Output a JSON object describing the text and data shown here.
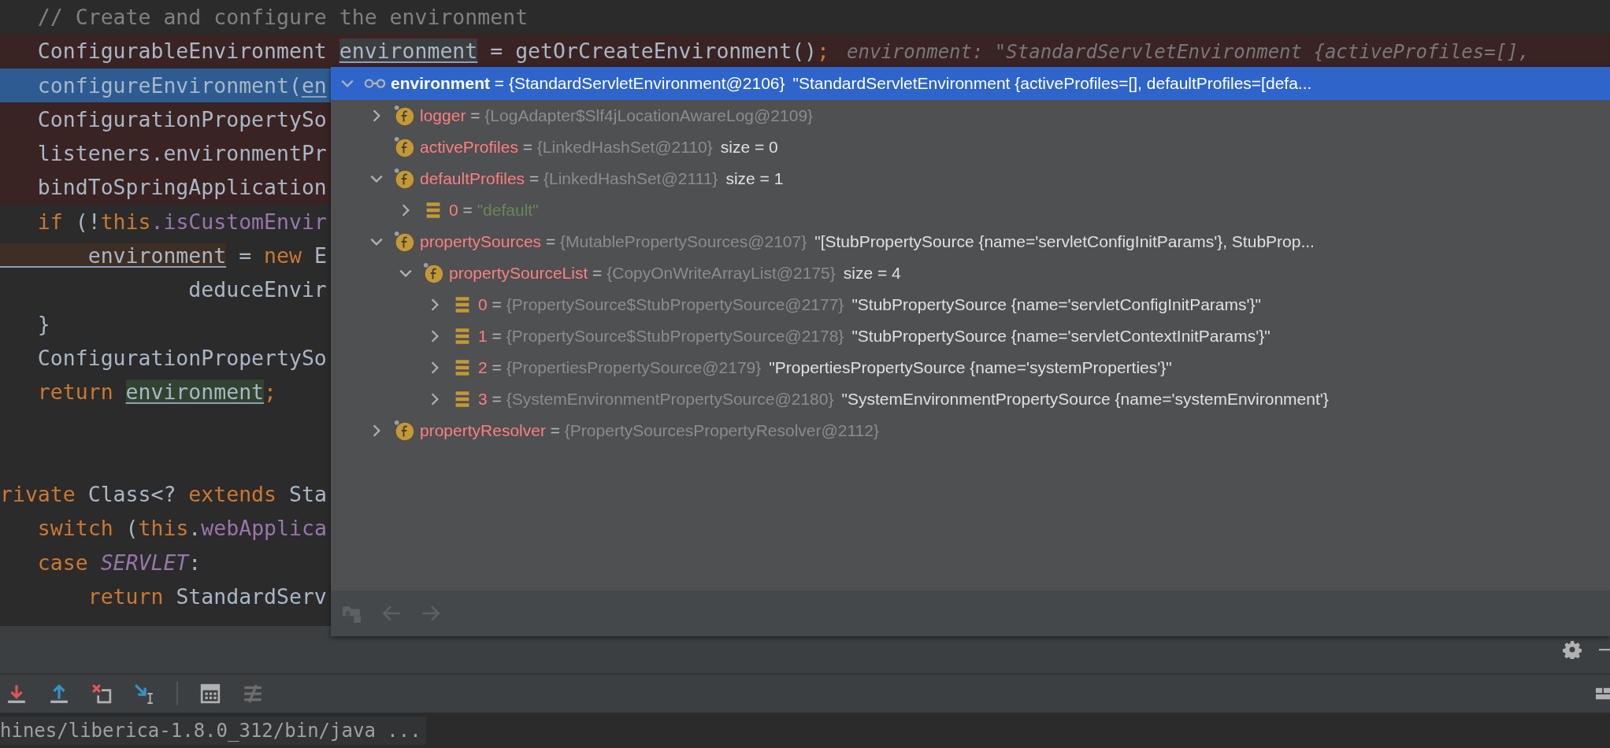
{
  "editor": {
    "lines": [
      {
        "breakpoint": false,
        "execution_point": false,
        "segments": [
          {
            "text": "   // Create and configure the environment",
            "kind": "comment"
          }
        ]
      },
      {
        "breakpoint": true,
        "execution_point": false,
        "segments": [
          {
            "text": "   ConfigurableEnvironment ",
            "kind": "plain"
          },
          {
            "text": "environment",
            "kind": "ref-hover"
          },
          {
            "text": " = getOrCreateEnvironment()",
            "kind": "plain"
          },
          {
            "text": ";",
            "kind": "keyword"
          },
          {
            "text": "environment: \"StandardServletEnvironment {activeProfiles=[],",
            "kind": "hint"
          }
        ]
      },
      {
        "breakpoint": false,
        "execution_point": true,
        "segments": [
          {
            "text": "   configureEnvironment(",
            "kind": "plain"
          },
          {
            "text": "en",
            "kind": "ref"
          }
        ]
      },
      {
        "breakpoint": true,
        "execution_point": false,
        "segments": [
          {
            "text": "   ConfigurationPropertySo",
            "kind": "plain"
          }
        ]
      },
      {
        "breakpoint": true,
        "execution_point": false,
        "segments": [
          {
            "text": "   listeners.environmentPr",
            "kind": "plain"
          }
        ]
      },
      {
        "breakpoint": true,
        "execution_point": false,
        "segments": [
          {
            "text": "   bindToSpringApplication",
            "kind": "plain"
          }
        ]
      },
      {
        "breakpoint": false,
        "execution_point": false,
        "segments": [
          {
            "text": "   if",
            "kind": "keyword"
          },
          {
            "text": " (!",
            "kind": "plain"
          },
          {
            "text": "this",
            "kind": "keyword"
          },
          {
            "text": ".isCustomEnvir",
            "kind": "field"
          }
        ]
      },
      {
        "breakpoint": false,
        "execution_point": false,
        "segments": [
          {
            "text": "       environment",
            "kind": "ref-write"
          },
          {
            "text": " = ",
            "kind": "plain"
          },
          {
            "text": "new",
            "kind": "keyword"
          },
          {
            "text": " E",
            "kind": "plain"
          }
        ]
      },
      {
        "breakpoint": false,
        "execution_point": false,
        "segments": [
          {
            "text": "               deduceEnvir",
            "kind": "plain"
          }
        ]
      },
      {
        "breakpoint": false,
        "execution_point": false,
        "segments": [
          {
            "text": "   }",
            "kind": "plain"
          }
        ]
      },
      {
        "breakpoint": false,
        "execution_point": false,
        "segments": [
          {
            "text": "   ConfigurationPropertySo",
            "kind": "plain"
          }
        ]
      },
      {
        "breakpoint": false,
        "execution_point": false,
        "segments": [
          {
            "text": "   return ",
            "kind": "keyword"
          },
          {
            "text": "environment",
            "kind": "ref-read"
          },
          {
            "text": ";",
            "kind": "keyword"
          }
        ]
      },
      {
        "breakpoint": false,
        "execution_point": false
      },
      {
        "breakpoint": false,
        "execution_point": false
      },
      {
        "breakpoint": false,
        "execution_point": false,
        "segments": [
          {
            "text": "rivate",
            "kind": "keyword"
          },
          {
            "text": " Class<? ",
            "kind": "plain"
          },
          {
            "text": "extends",
            "kind": "keyword"
          },
          {
            "text": " Sta",
            "kind": "plain"
          }
        ]
      },
      {
        "breakpoint": false,
        "execution_point": false,
        "segments": [
          {
            "text": "   switch",
            "kind": "keyword"
          },
          {
            "text": " (",
            "kind": "plain"
          },
          {
            "text": "this",
            "kind": "keyword"
          },
          {
            "text": ".",
            "kind": "plain"
          },
          {
            "text": "webApplica",
            "kind": "field"
          }
        ]
      },
      {
        "breakpoint": false,
        "execution_point": false,
        "segments": [
          {
            "text": "   case ",
            "kind": "keyword"
          },
          {
            "text": "SERVLET",
            "kind": "constant"
          },
          {
            "text": ":",
            "kind": "plain"
          }
        ]
      },
      {
        "breakpoint": false,
        "execution_point": false,
        "segments": [
          {
            "text": "       return",
            "kind": "keyword"
          },
          {
            "text": " StandardServ",
            "kind": "plain"
          }
        ]
      }
    ]
  },
  "debug_popup": {
    "tree": [
      {
        "kind": "watch",
        "name": "environment",
        "expanded": true,
        "selected": true,
        "parts": [
          {
            "text": " = ",
            "kind": "op"
          },
          {
            "text": "{StandardServletEnvironment@2106}",
            "kind": "ref"
          },
          {
            "text": "\"StandardServletEnvironment {activeProfiles=[], defaultProfiles=[defa...",
            "kind": "desc"
          }
        ],
        "children": [
          {
            "kind": "field",
            "name": "logger",
            "expanded": false,
            "selected": false,
            "parts": [
              {
                "text": " = ",
                "kind": "op"
              },
              {
                "text": "{LogAdapter$Slf4jLocationAwareLog@2109}",
                "kind": "ref"
              }
            ]
          },
          {
            "kind": "leaf-field",
            "name": "activeProfiles",
            "selected": false,
            "parts": [
              {
                "text": " = ",
                "kind": "op"
              },
              {
                "text": "{LinkedHashSet@2110}",
                "kind": "ref"
              },
              {
                "text": "size = 0",
                "kind": "desc"
              }
            ]
          },
          {
            "kind": "field",
            "name": "defaultProfiles",
            "expanded": true,
            "selected": false,
            "parts": [
              {
                "text": " = ",
                "kind": "op"
              },
              {
                "text": "{LinkedHashSet@2111}",
                "kind": "ref"
              },
              {
                "text": "size = 1",
                "kind": "desc"
              }
            ],
            "children": [
              {
                "kind": "element",
                "name": "0",
                "expanded": false,
                "selected": false,
                "parts": [
                  {
                    "text": " = ",
                    "kind": "op"
                  },
                  {
                    "text": "\"default\"",
                    "kind": "literal"
                  }
                ]
              }
            ]
          },
          {
            "kind": "field",
            "name": "propertySources",
            "expanded": true,
            "selected": false,
            "parts": [
              {
                "text": " = ",
                "kind": "op"
              },
              {
                "text": "{MutablePropertySources@2107}",
                "kind": "ref"
              },
              {
                "text": "\"[StubPropertySource {name='servletConfigInitParams'}, StubProp...",
                "kind": "desc"
              }
            ],
            "children": [
              {
                "kind": "field",
                "name": "propertySourceList",
                "expanded": true,
                "selected": false,
                "parts": [
                  {
                    "text": " = ",
                    "kind": "op"
                  },
                  {
                    "text": "{CopyOnWriteArrayList@2175}",
                    "kind": "ref"
                  },
                  {
                    "text": "size = 4",
                    "kind": "desc"
                  }
                ],
                "children": [
                  {
                    "kind": "element",
                    "name": "0",
                    "expanded": false,
                    "selected": false,
                    "parts": [
                      {
                        "text": " = ",
                        "kind": "op"
                      },
                      {
                        "text": "{PropertySource$StubPropertySource@2177}",
                        "kind": "ref"
                      },
                      {
                        "text": "\"StubPropertySource {name='servletConfigInitParams'}\"",
                        "kind": "desc"
                      }
                    ]
                  },
                  {
                    "kind": "element",
                    "name": "1",
                    "expanded": false,
                    "selected": false,
                    "parts": [
                      {
                        "text": " = ",
                        "kind": "op"
                      },
                      {
                        "text": "{PropertySource$StubPropertySource@2178}",
                        "kind": "ref"
                      },
                      {
                        "text": "\"StubPropertySource {name='servletContextInitParams'}\"",
                        "kind": "desc"
                      }
                    ]
                  },
                  {
                    "kind": "element",
                    "name": "2",
                    "expanded": false,
                    "selected": false,
                    "parts": [
                      {
                        "text": " = ",
                        "kind": "op"
                      },
                      {
                        "text": "{PropertiesPropertySource@2179}",
                        "kind": "ref"
                      },
                      {
                        "text": "\"PropertiesPropertySource {name='systemProperties'}\"",
                        "kind": "desc"
                      }
                    ]
                  },
                  {
                    "kind": "element",
                    "name": "3",
                    "expanded": false,
                    "selected": false,
                    "parts": [
                      {
                        "text": " = ",
                        "kind": "op"
                      },
                      {
                        "text": "{SystemEnvironmentPropertySource@2180}",
                        "kind": "ref"
                      },
                      {
                        "text": "\"SystemEnvironmentPropertySource {name='systemEnvironment'}",
                        "kind": "desc"
                      }
                    ]
                  }
                ]
              }
            ]
          },
          {
            "kind": "field",
            "name": "propertyResolver",
            "expanded": false,
            "selected": false,
            "parts": [
              {
                "text": " = ",
                "kind": "op"
              },
              {
                "text": "{PropertySourcesPropertyResolver@2112}",
                "kind": "ref"
              }
            ]
          }
        ]
      }
    ]
  },
  "console": {
    "text": "hines/liberica-1.8.0_312/bin/java ..."
  }
}
